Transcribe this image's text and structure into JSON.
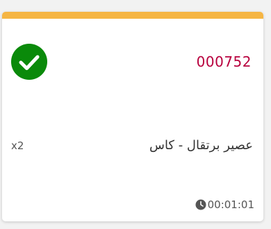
{
  "order": {
    "number": "000752",
    "status_icon": "check-circle-icon",
    "accent_color": "#f5b544",
    "number_color": "#b8003e",
    "status_color": "#0a8a0a"
  },
  "item": {
    "name": "عصير برتقال - كاس",
    "quantity": "x2"
  },
  "timer": {
    "icon": "clock-icon",
    "elapsed": "00:01:01"
  }
}
